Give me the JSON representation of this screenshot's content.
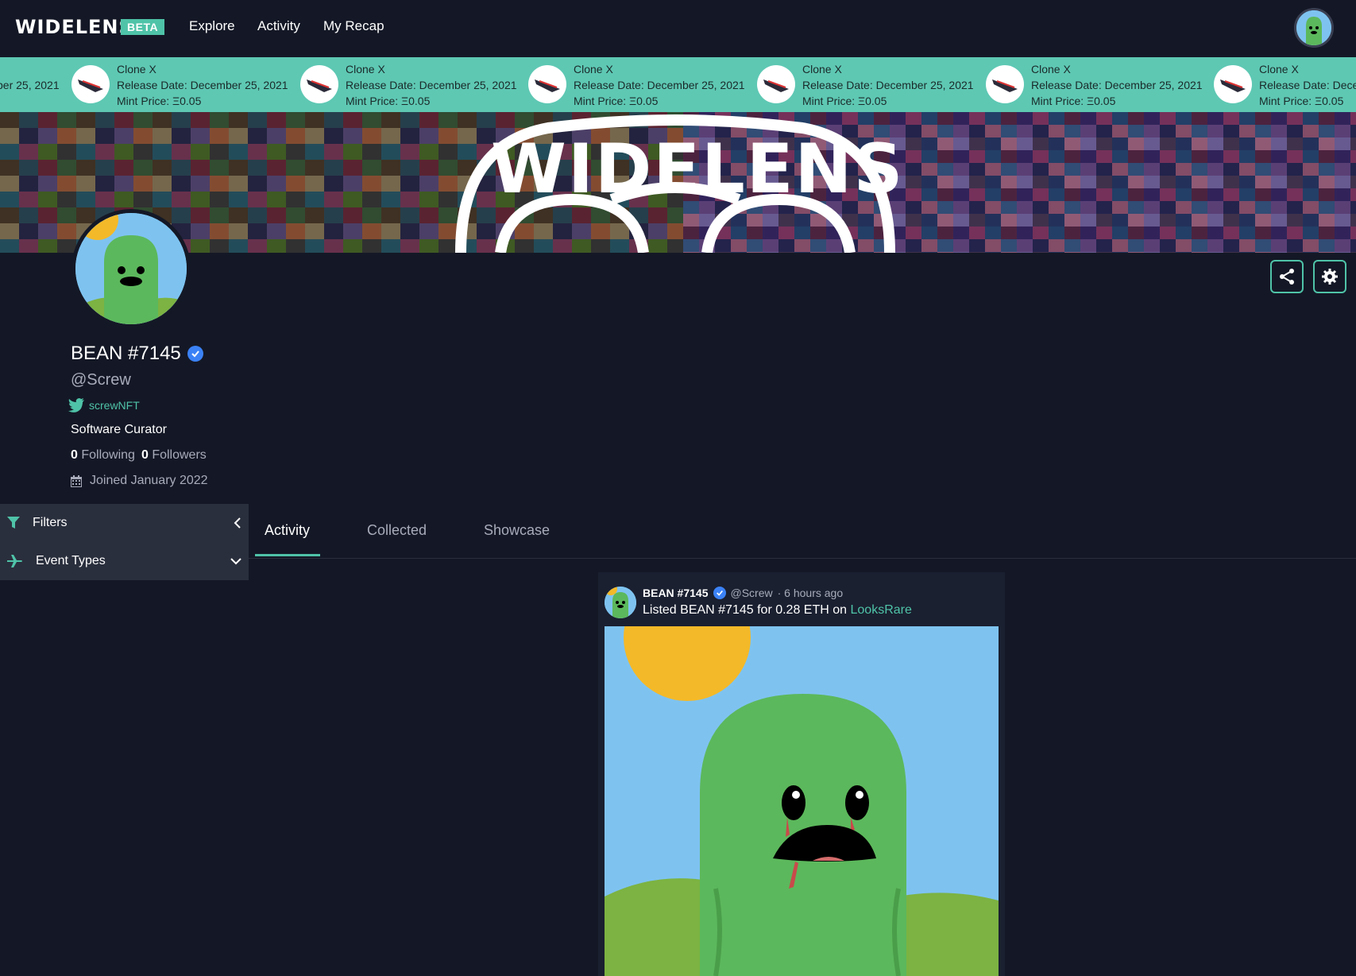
{
  "nav": {
    "logo": "WIDELENS",
    "badge": "BETA",
    "links": [
      "Explore",
      "Activity",
      "My Recap"
    ]
  },
  "ticker": {
    "items": [
      {
        "name": "Clone X",
        "release": "Release Date: December 25, 2021",
        "mint": "Mint Price: Ξ0.05"
      },
      {
        "name": "Clone X",
        "release": "Release Date: December 25, 2021",
        "mint": "Mint Price: Ξ0.05"
      },
      {
        "name": "Clone X",
        "release": "Release Date: December 25, 2021",
        "mint": "Mint Price: Ξ0.05"
      },
      {
        "name": "Clone X",
        "release": "Release Date: December 25, 2021",
        "mint": "Mint Price: Ξ0.05"
      },
      {
        "name": "Clone X",
        "release": "Release Date: December 25, 2021",
        "mint": "Mint Price: Ξ0.05"
      },
      {
        "name": "Clone X",
        "release": "Release Date: Dece",
        "mint": "Mint Price: Ξ0.05"
      }
    ],
    "leading_fragment": "ber 25, 2021"
  },
  "banner": {
    "logo_text": "WIDELENS"
  },
  "profile": {
    "name": "BEAN #7145",
    "handle": "@Screw",
    "twitter": "screwNFT",
    "bio": "Software Curator",
    "following_count": "0",
    "following_label": "Following",
    "followers_count": "0",
    "followers_label": "Followers",
    "joined": "Joined January 2022"
  },
  "filters": {
    "title": "Filters",
    "event_types": "Event Types"
  },
  "tabs": [
    "Activity",
    "Collected",
    "Showcase"
  ],
  "activity": {
    "name": "BEAN #7145",
    "handle": "@Screw",
    "time": "· 6 hours ago",
    "desc_prefix": "Listed BEAN #7145 for 0.28 ETH on",
    "marketplace": "LooksRare"
  },
  "colors": {
    "accent": "#4fc3a8",
    "background": "#141826",
    "panel": "#2a2f3d",
    "verified": "#3b82f6"
  }
}
